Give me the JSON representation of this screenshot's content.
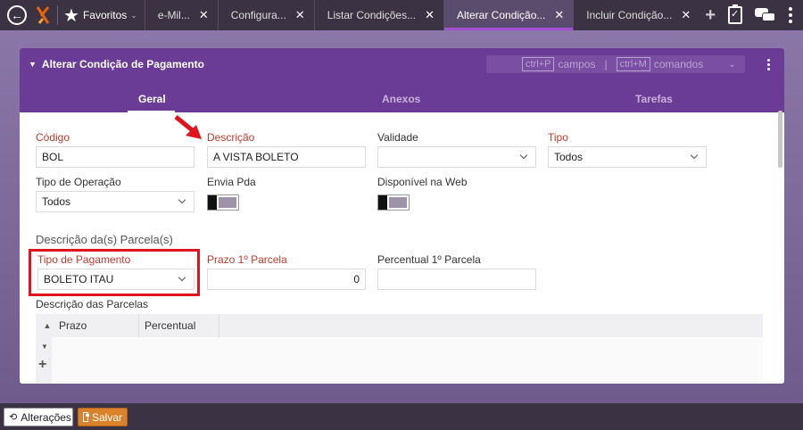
{
  "topbar": {
    "favorites_label": "Favoritos",
    "tabs": [
      {
        "label": "e-Mil..."
      },
      {
        "label": "Configura..."
      },
      {
        "label": "Listar Condições..."
      },
      {
        "label": "Alterar Condição..."
      },
      {
        "label": "Incluir Condição..."
      }
    ]
  },
  "panel": {
    "title": "Alterar Condição de Pagamento",
    "shortcut_fields_key": "ctrl+P",
    "shortcut_fields_label": "campos",
    "shortcut_sep": "|",
    "shortcut_commands_key": "ctrl+M",
    "shortcut_commands_label": "comandos",
    "tabs": [
      {
        "label": "Geral"
      },
      {
        "label": "Anexos"
      },
      {
        "label": "Tarefas"
      }
    ]
  },
  "form": {
    "codigo_label": "Código",
    "codigo_value": "BOL",
    "descricao_label": "Descrição",
    "descricao_value": "A VISTA BOLETO",
    "validade_label": "Validade",
    "validade_value": "",
    "tipo_label": "Tipo",
    "tipo_value": "Todos",
    "tipo_operacao_label": "Tipo de Operação",
    "tipo_operacao_value": "Todos",
    "envia_pda_label": "Envia Pda",
    "disponivel_web_label": "Disponível na Web",
    "section_parcelas": "Descrição da(s) Parcela(s)",
    "tipo_pagamento_label": "Tipo de Pagamento",
    "tipo_pagamento_value": "BOLETO ITAU",
    "prazo_label": "Prazo 1º Parcela",
    "prazo_value": "0",
    "percentual_label": "Percentual 1º Parcela",
    "percentual_value": "",
    "descricao_parcelas_label": "Descrição das Parcelas",
    "grid_columns": [
      "Prazo",
      "Percentual"
    ]
  },
  "bottombar": {
    "alteracoes_label": "Alterações",
    "salvar_label": "Salvar"
  },
  "colors": {
    "panel_header": "#6b3c96",
    "required_label": "#c0392b",
    "highlight": "#e0141e",
    "save_button": "#d9822b"
  }
}
